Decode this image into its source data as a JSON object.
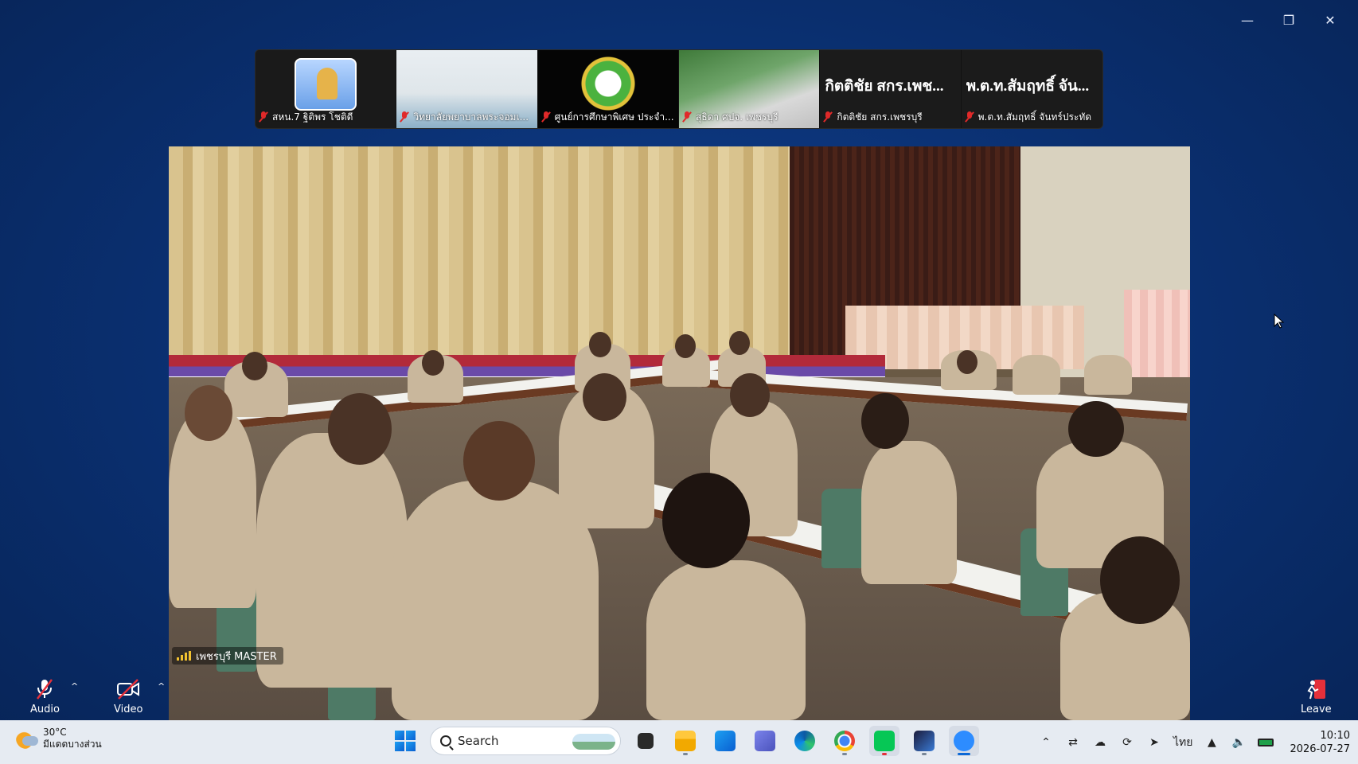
{
  "window": {
    "minimize_icon": "minimize-icon",
    "restore_icon": "restore-icon",
    "close_icon": "close-icon"
  },
  "participants": [
    {
      "name": "สหน.7  ฐิติพร โชติดี",
      "muted": true,
      "big_name": ""
    },
    {
      "name": "วิทยาลัยพยาบาลพระจอมเ...",
      "muted": true,
      "big_name": ""
    },
    {
      "name": "ศูนย์การศึกษาพิเศษ ประจำ...",
      "muted": true,
      "big_name": ""
    },
    {
      "name": "สุธิดา ศปจ. เพชรบุรี",
      "muted": true,
      "big_name": ""
    },
    {
      "name": "กิตติชัย สกร.เพชรบุรี",
      "muted": true,
      "big_name": "กิตติชัย สกร.เพช..."
    },
    {
      "name": "พ.ต.ท.สัมฤทธิ์ จันทร์ประทัด",
      "muted": true,
      "big_name": "พ.ต.ท.สัมฤทธิ์ จัน..."
    }
  ],
  "main_video": {
    "speaker_name": "เพชรบุรี MASTER"
  },
  "controls": {
    "audio_label": "Audio",
    "video_label": "Video",
    "leave_label": "Leave"
  },
  "taskbar": {
    "weather_temp": "30°C",
    "weather_desc": "มีแดดบางส่วน",
    "search_placeholder": "Search",
    "language": "ไทย",
    "time": "10:10",
    "date": "2026-07-27"
  }
}
